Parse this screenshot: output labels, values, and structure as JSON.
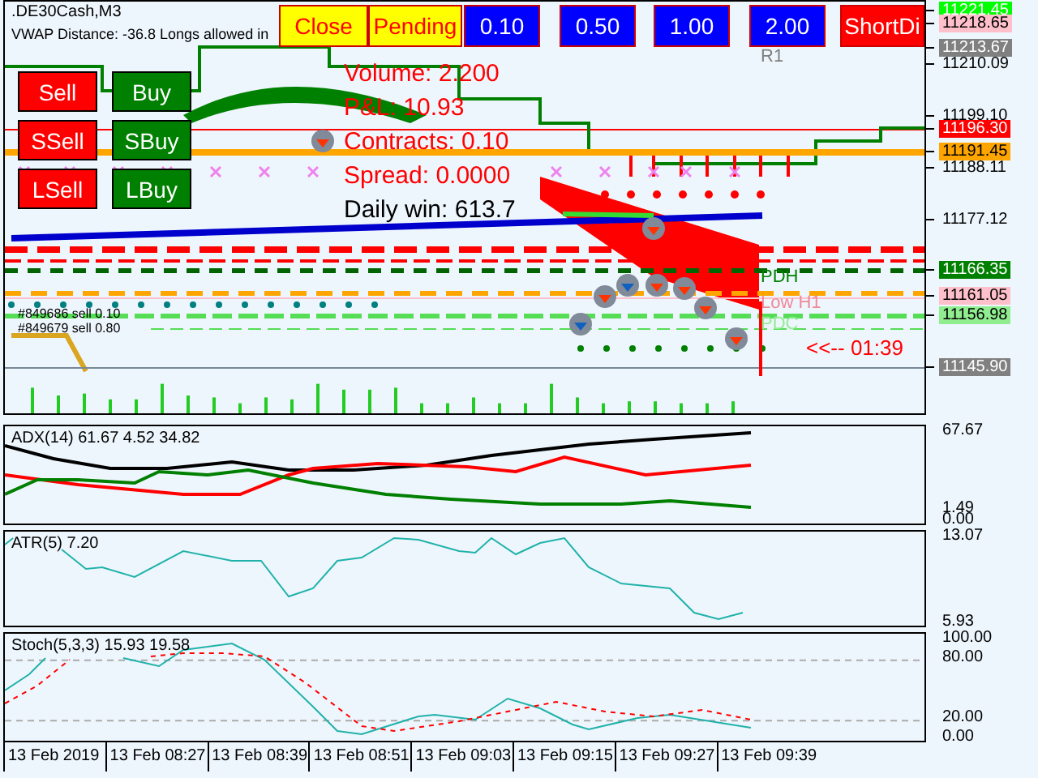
{
  "chart": {
    "symbol_title": ".DE30Cash,M3",
    "info_line": "VWAP Distance: -36.8 Longs allowed in",
    "toolbar_buttons": [
      {
        "label": "Close",
        "kind": "action"
      },
      {
        "label": "Pending",
        "kind": "action"
      },
      {
        "label": "0.10",
        "kind": "lot"
      },
      {
        "label": "0.50",
        "kind": "lot"
      },
      {
        "label": "1.00",
        "kind": "lot"
      },
      {
        "label": "2.00",
        "kind": "lot"
      },
      {
        "label": "ShortDi",
        "kind": "direction"
      }
    ],
    "trade_buttons": [
      {
        "label": "Sell",
        "kind": "sell"
      },
      {
        "label": "Buy",
        "kind": "buy"
      },
      {
        "label": "SSell",
        "kind": "sell"
      },
      {
        "label": "SBuy",
        "kind": "buy"
      },
      {
        "label": "LSell",
        "kind": "sell"
      },
      {
        "label": "LBuy",
        "kind": "buy"
      }
    ],
    "stats": [
      {
        "text": "Volume: 2.200",
        "color": "#ff0000"
      },
      {
        "text": "P&L: 10.93",
        "color": "#ff0000"
      },
      {
        "text": "Contracts: 0.10",
        "color": "#ff0000"
      },
      {
        "text": "Spread: 0.0000",
        "color": "#ff0000"
      },
      {
        "text": "Daily win: 613.7",
        "color": "#000000"
      }
    ],
    "level_labels": [
      {
        "text": "R1",
        "color": "#808080"
      },
      {
        "text": "PDH",
        "color": "#008000"
      },
      {
        "text": "Low H1",
        "color": "#f08898"
      },
      {
        "text": "PDC",
        "color": "#90ee90"
      }
    ],
    "countdown": "<<-- 01:39",
    "trade_labels": [
      "#849686 sell 0.10",
      "#849679 sell 0.80"
    ],
    "price_axis": [
      {
        "text": "11221.45",
        "color": "#00ff00"
      },
      {
        "text": "11218.65",
        "color": "#ffc0cb"
      },
      {
        "text": "11213.67",
        "color": "#808080"
      },
      {
        "text": "11210.09"
      },
      {
        "text": "11199.10"
      },
      {
        "text": "11196.30",
        "color": "#ff0000"
      },
      {
        "text": "11191.45",
        "color": "#ffa500"
      },
      {
        "text": "11188.11"
      },
      {
        "text": "11177.12"
      },
      {
        "text": "11166.35",
        "color": "#008000"
      },
      {
        "text": "11161.05",
        "color": "#ffc0cb"
      },
      {
        "text": "11156.98",
        "color": "#90ee90"
      },
      {
        "text": "11145.90",
        "color": "#808080"
      }
    ]
  },
  "indicators": [
    {
      "kind": "adx",
      "title": "ADX(14) 61.67 4.52 34.82",
      "axis_labels": [
        "67.67",
        "1.49",
        "0.00"
      ]
    },
    {
      "kind": "atr",
      "title": "ATR(5) 7.20",
      "axis_labels": [
        "13.07",
        "5.93"
      ]
    },
    {
      "kind": "stoch",
      "title": "Stoch(5,3,3) 15.93 19.58",
      "axis_labels": [
        "100.00",
        "80.00",
        "20.00",
        "0.00"
      ]
    }
  ],
  "time_axis": [
    "13 Feb 2019",
    "13 Feb 08:27",
    "13 Feb 08:39",
    "13 Feb 08:51",
    "13 Feb 09:03",
    "13 Feb 09:15",
    "13 Feb 09:27",
    "13 Feb 09:39"
  ]
}
